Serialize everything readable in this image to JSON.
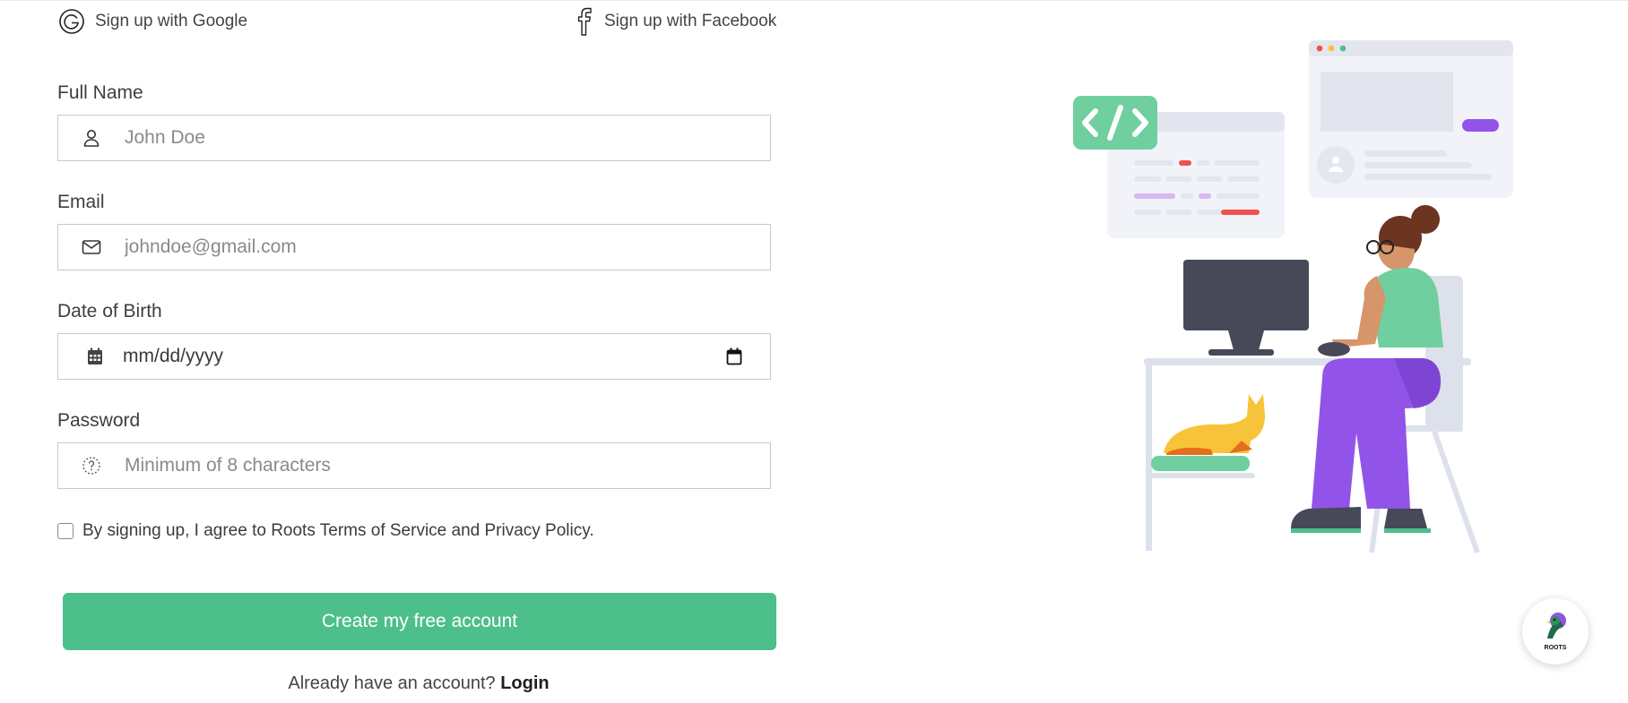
{
  "social": {
    "google_label": "Sign up with Google",
    "facebook_label": "Sign up with Facebook"
  },
  "form": {
    "full_name": {
      "label": "Full Name",
      "placeholder": "John Doe",
      "icon": "user-icon"
    },
    "email": {
      "label": "Email",
      "placeholder": "johndoe@gmail.com",
      "icon": "mail-icon"
    },
    "dob": {
      "label": "Date of Birth",
      "value": "mm/dd/yyyy",
      "icon": "calendar-icon"
    },
    "password": {
      "label": "Password",
      "placeholder": "Minimum of 8 characters",
      "icon": "lock-help-icon"
    },
    "terms": "By signing up, I agree to Roots Terms of Service and Privacy Policy.",
    "submit_label": "Create my free account"
  },
  "footer": {
    "prompt": "Already have an account?",
    "login_label": "Login"
  },
  "badge": {
    "label": "ROOTS"
  },
  "colors": {
    "accent": "#4dbf8b",
    "purple": "#9254e8",
    "dark": "#474959"
  }
}
